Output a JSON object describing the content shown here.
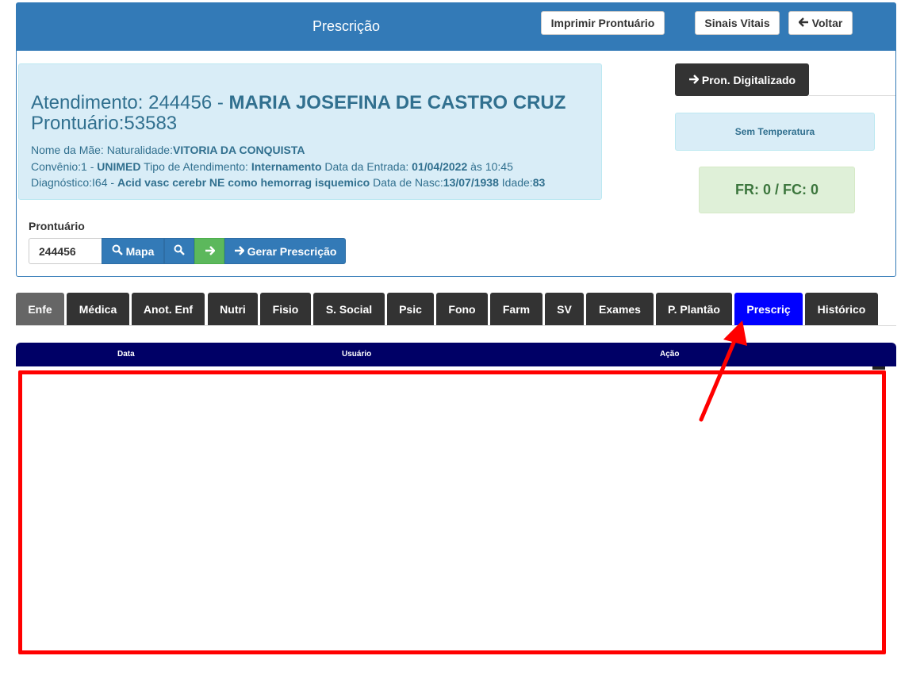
{
  "header": {
    "title": "Prescrição",
    "print_button": "Imprimir Prontuário",
    "vitals_button": "Sinais Vitais",
    "back_button": "Voltar"
  },
  "patient": {
    "atendimento_label": "Atendimento: 244456 - ",
    "name": "MARIA JOSEFINA DE CASTRO CRUZ",
    "prontuario_line": "Prontuário:53583",
    "mae_label": "Nome da Mãe: Naturalidade:",
    "naturalidade": "VITORIA DA CONQUISTA",
    "convenio_label": "Convênio:1 - ",
    "convenio": "UNIMED",
    "tipo_label": " Tipo de Atendimento: ",
    "tipo": "Internamento",
    "entrada_label": " Data da Entrada: ",
    "entrada": "01/04/2022",
    "entrada_hora": " às 10:45",
    "diag_label": "Diagnóstico:I64 - ",
    "diagnostico": "Acid vasc cerebr NE como hemorrag isquemico",
    "nasc_label": " Data de Nasc:",
    "nasc": "13/07/1938",
    "idade_label": " Idade:",
    "idade": "83"
  },
  "side": {
    "pron_digitalizado": "Pron. Digitalizado",
    "temperatura": "Sem Temperatura",
    "vitals": "FR: 0 / FC: 0"
  },
  "search": {
    "label": "Prontuário",
    "value": "244456",
    "mapa_button": "Mapa",
    "gerar_button": "Gerar Prescrição"
  },
  "tabs": [
    {
      "label": "Enfe"
    },
    {
      "label": "Médica"
    },
    {
      "label": "Anot. Enf"
    },
    {
      "label": "Nutri"
    },
    {
      "label": "Fisio"
    },
    {
      "label": "S. Social"
    },
    {
      "label": "Psic"
    },
    {
      "label": "Fono"
    },
    {
      "label": "Farm"
    },
    {
      "label": "SV"
    },
    {
      "label": "Exames"
    },
    {
      "label": "P. Plantão"
    },
    {
      "label": "Prescriç"
    },
    {
      "label": "Histórico"
    }
  ],
  "active_tab": "Prescriç",
  "table": {
    "columns": [
      "Data",
      "Usuário",
      "Ação"
    ],
    "rows": []
  },
  "colors": {
    "primary": "#337ab7",
    "active_tab": "#0000ff",
    "table_header": "#000066",
    "annotation": "#ff0000"
  }
}
